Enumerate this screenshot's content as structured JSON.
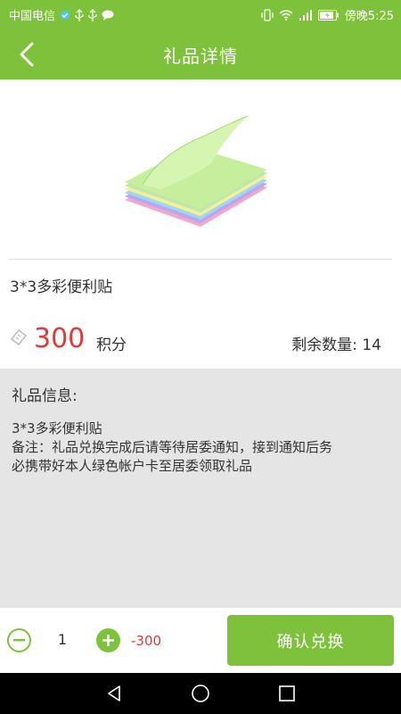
{
  "status_bar": {
    "carrier": "中国电信",
    "time": "傍晚5:25",
    "icons": [
      "vpn-icon",
      "usb-icon",
      "usb-icon",
      "chat-icon",
      "vibrate-icon",
      "wifi-icon",
      "signal-icon",
      "battery-icon"
    ]
  },
  "header": {
    "title": "礼品详情",
    "back_icon": "chevron-left-icon"
  },
  "product": {
    "name": "3*3多彩便利贴",
    "price": "300",
    "price_unit": "积分",
    "remaining_label": "剩余数量:",
    "remaining_value": "14"
  },
  "info": {
    "title": "礼品信息:",
    "line1": "3*3多彩便利贴",
    "line2": "备注：礼品兑换完成后请等待居委通知，接到通知后务",
    "line3": "必携带好本人绿色帐户卡至居委领取礼品"
  },
  "bottom": {
    "quantity": "1",
    "total": "-300",
    "confirm_label": "确认兑换"
  },
  "colors": {
    "accent": "#7ec13a",
    "price": "#e53935",
    "panel": "#e5e5e5"
  }
}
